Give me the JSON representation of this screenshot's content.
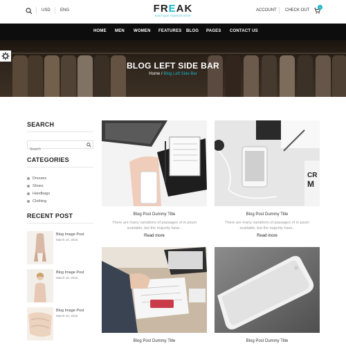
{
  "topbar": {
    "currency": "USD",
    "language": "ENG",
    "account": "ACCOUNT",
    "checkout": "CHECK OUT",
    "cart_count": "0"
  },
  "logo": {
    "name_pre": "FR",
    "name_accent": "E",
    "name_post": "AK",
    "tagline": "BOUTIQUE FASHION SHOP"
  },
  "nav": [
    "HOME",
    "MEN",
    "WOMEN",
    "FEATURES",
    "BLOG",
    "PAGES",
    "CONTACT US"
  ],
  "banner": {
    "title": "BLOG LEFT SIDE BAR",
    "crumb_home": "Home",
    "crumb_sep": "/",
    "crumb_current": "Blog Left Side Bar"
  },
  "sidebar": {
    "search_heading": "SEARCH",
    "search_placeholder": "Search",
    "categories_heading": "CATEGORIES",
    "categories": [
      "Dresses",
      "Shoes",
      "Handbags",
      "Clothing"
    ],
    "recent_heading": "RECENT POST",
    "recent": [
      {
        "title": "Blog Image Post",
        "date": "March 10, 2015"
      },
      {
        "title": "Blog Image Post",
        "date": "March 10, 2015"
      },
      {
        "title": "Blog Image Post",
        "date": "March 10, 2015"
      }
    ]
  },
  "posts": [
    {
      "title": "Blog Post Dummy Title",
      "excerpt1": "There are many variations of passages of in psum",
      "excerpt2": "available, but the majority have..",
      "read_more": "Read more"
    },
    {
      "title": "Blog Post Dummy Title",
      "excerpt1": "There are many variations of passages of in psum",
      "excerpt2": "available, but the majority have..",
      "read_more": "Read more"
    },
    {
      "title": "Blog Post Dummy Title"
    },
    {
      "title": "Blog Post Dummy Title"
    }
  ],
  "colors": {
    "accent": "#13b5c8",
    "nav_bg": "#0d0d0d"
  },
  "icons": [
    "search-icon",
    "cart-icon",
    "gear-icon",
    "magnifier-icon"
  ]
}
